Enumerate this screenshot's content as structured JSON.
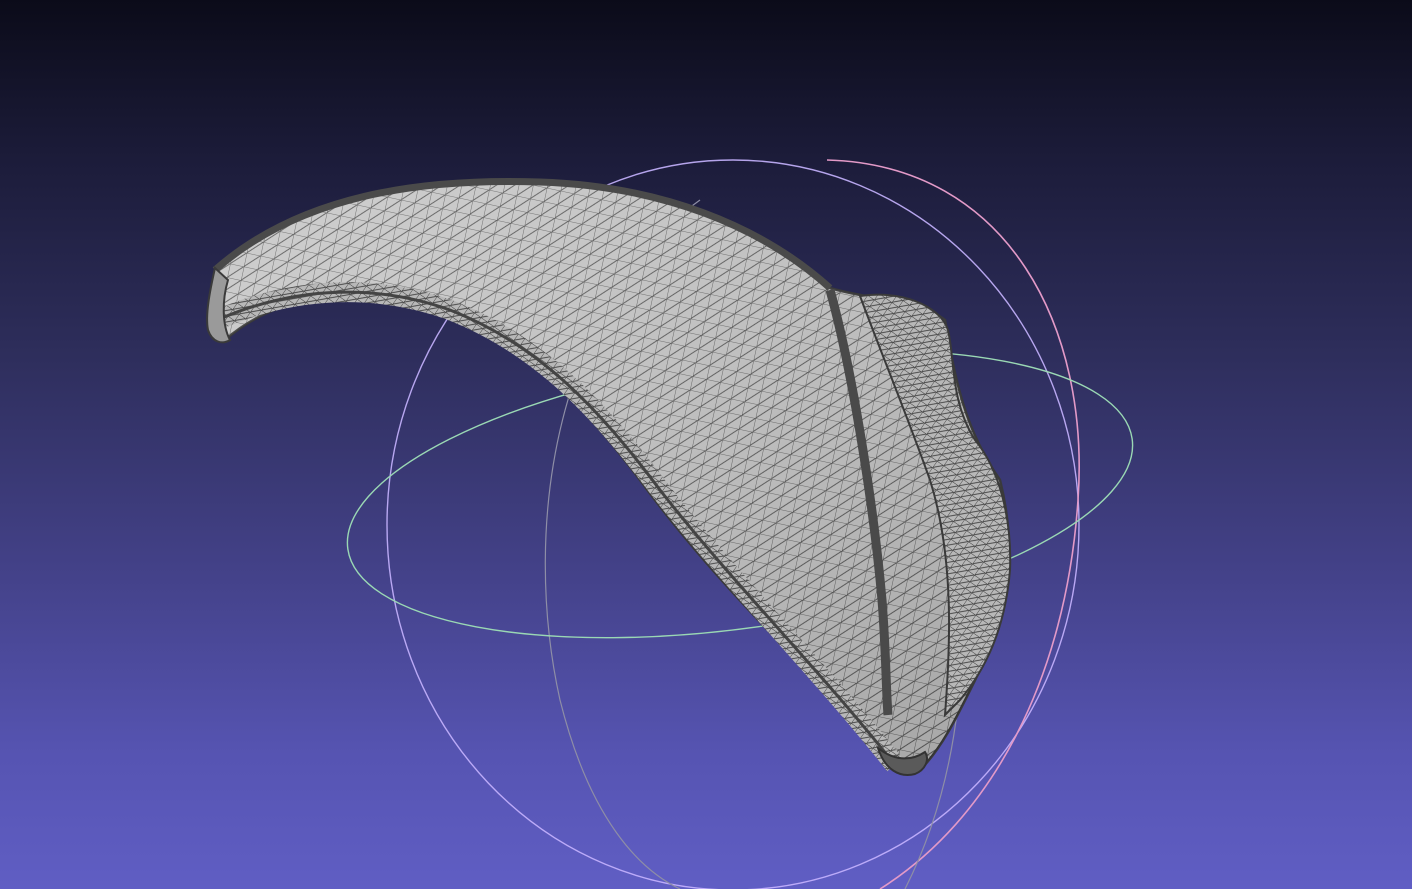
{
  "viewer": {
    "background_top": "#0b0b19",
    "background_bottom": "#605ec4",
    "mesh_fill": "#c9c9c9",
    "mesh_wire": "#4a4a4a",
    "trackball_colors": {
      "horizontal_ring": "#9ad8b4",
      "vertical_ring_x": "#b9a6ff",
      "vertical_ring_z": "#e59ac8",
      "front_ring": "#8a8aa0"
    }
  }
}
